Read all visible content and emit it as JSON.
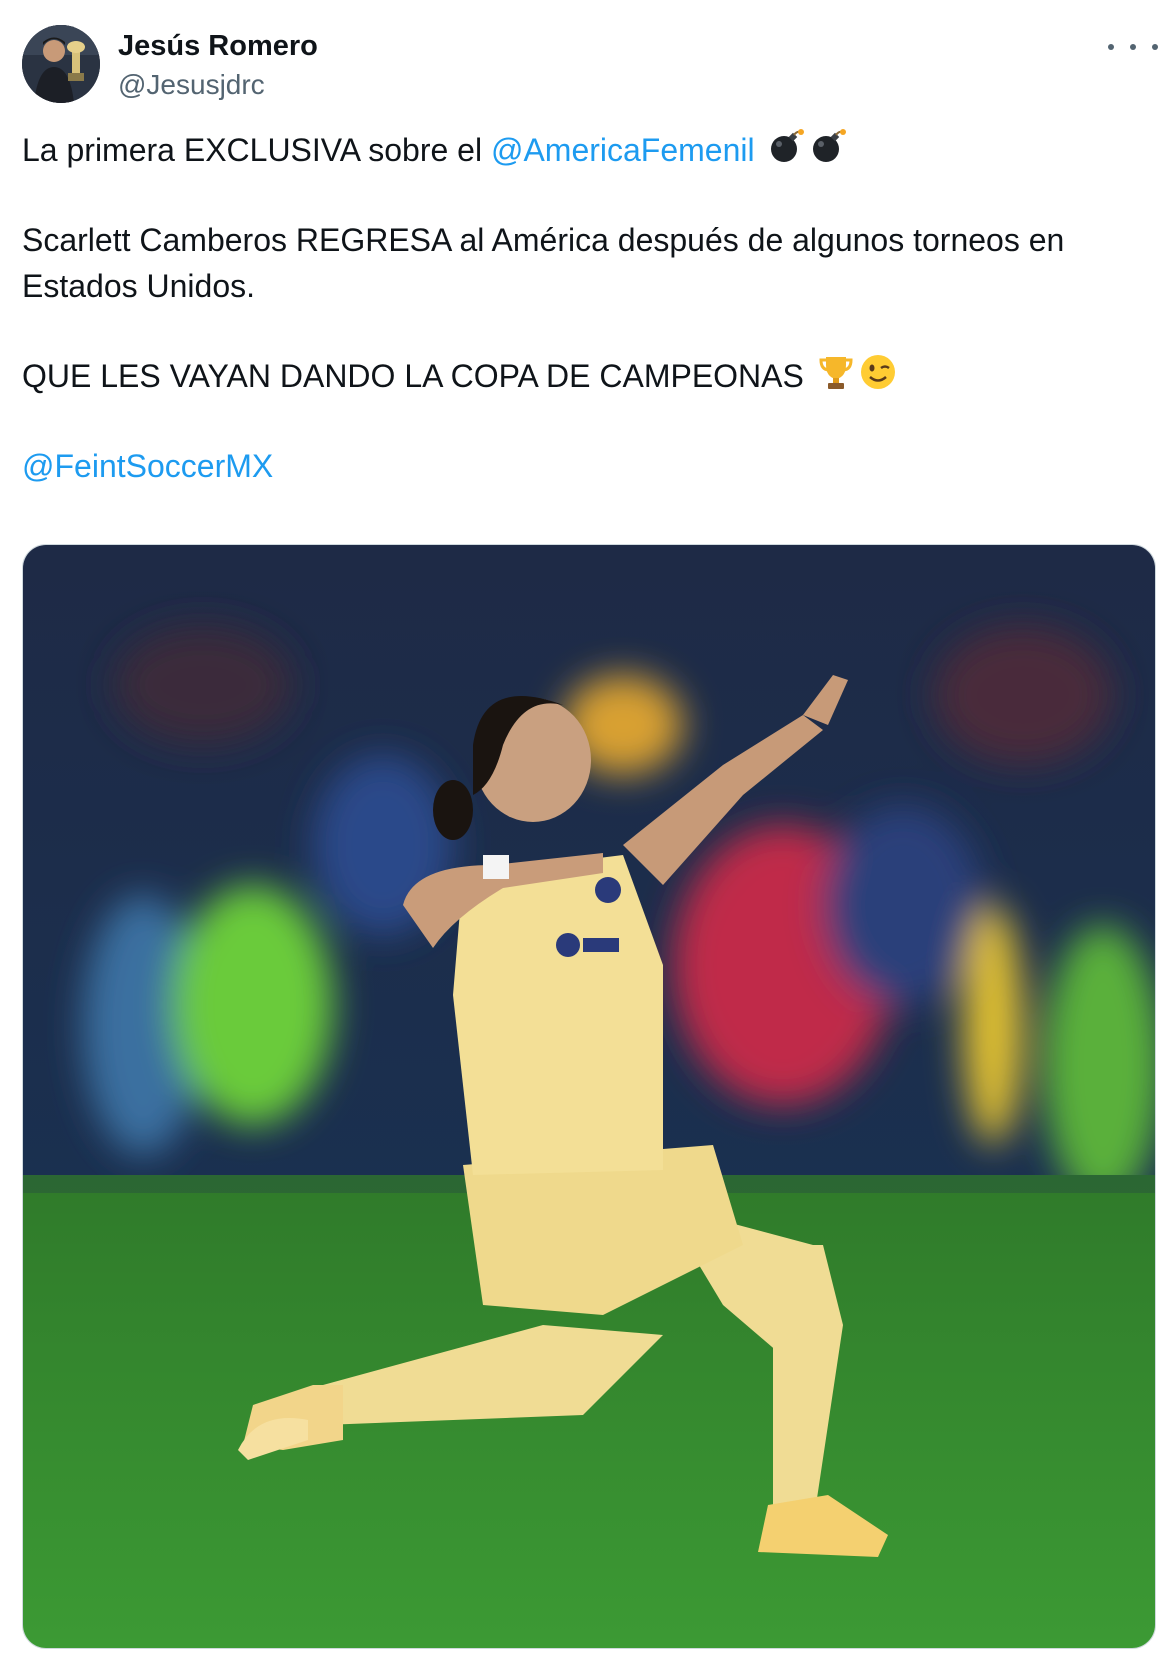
{
  "author": {
    "name": "Jesús Romero",
    "handle": "@Jesusjdrc"
  },
  "tweet": {
    "line1_text": "La primera EXCLUSIVA sobre el ",
    "line1_mention": "@AmericaFemenil",
    "line2": "Scarlett Camberos REGRESA al América después de algunos torneos en",
    "line3": "Estados Unidos.",
    "line4": "QUE LES VAYAN DANDO LA COPA DE CAMPEONAS",
    "mention2": "@FeintSoccerMX"
  },
  "emojis": [
    "bomb-icon",
    "bomb-icon",
    "trophy-icon",
    "winking-face-icon"
  ],
  "colors": {
    "mention": "#1d9bf0",
    "kit": "#f0dc94",
    "pitch": "#2f8a2a"
  }
}
